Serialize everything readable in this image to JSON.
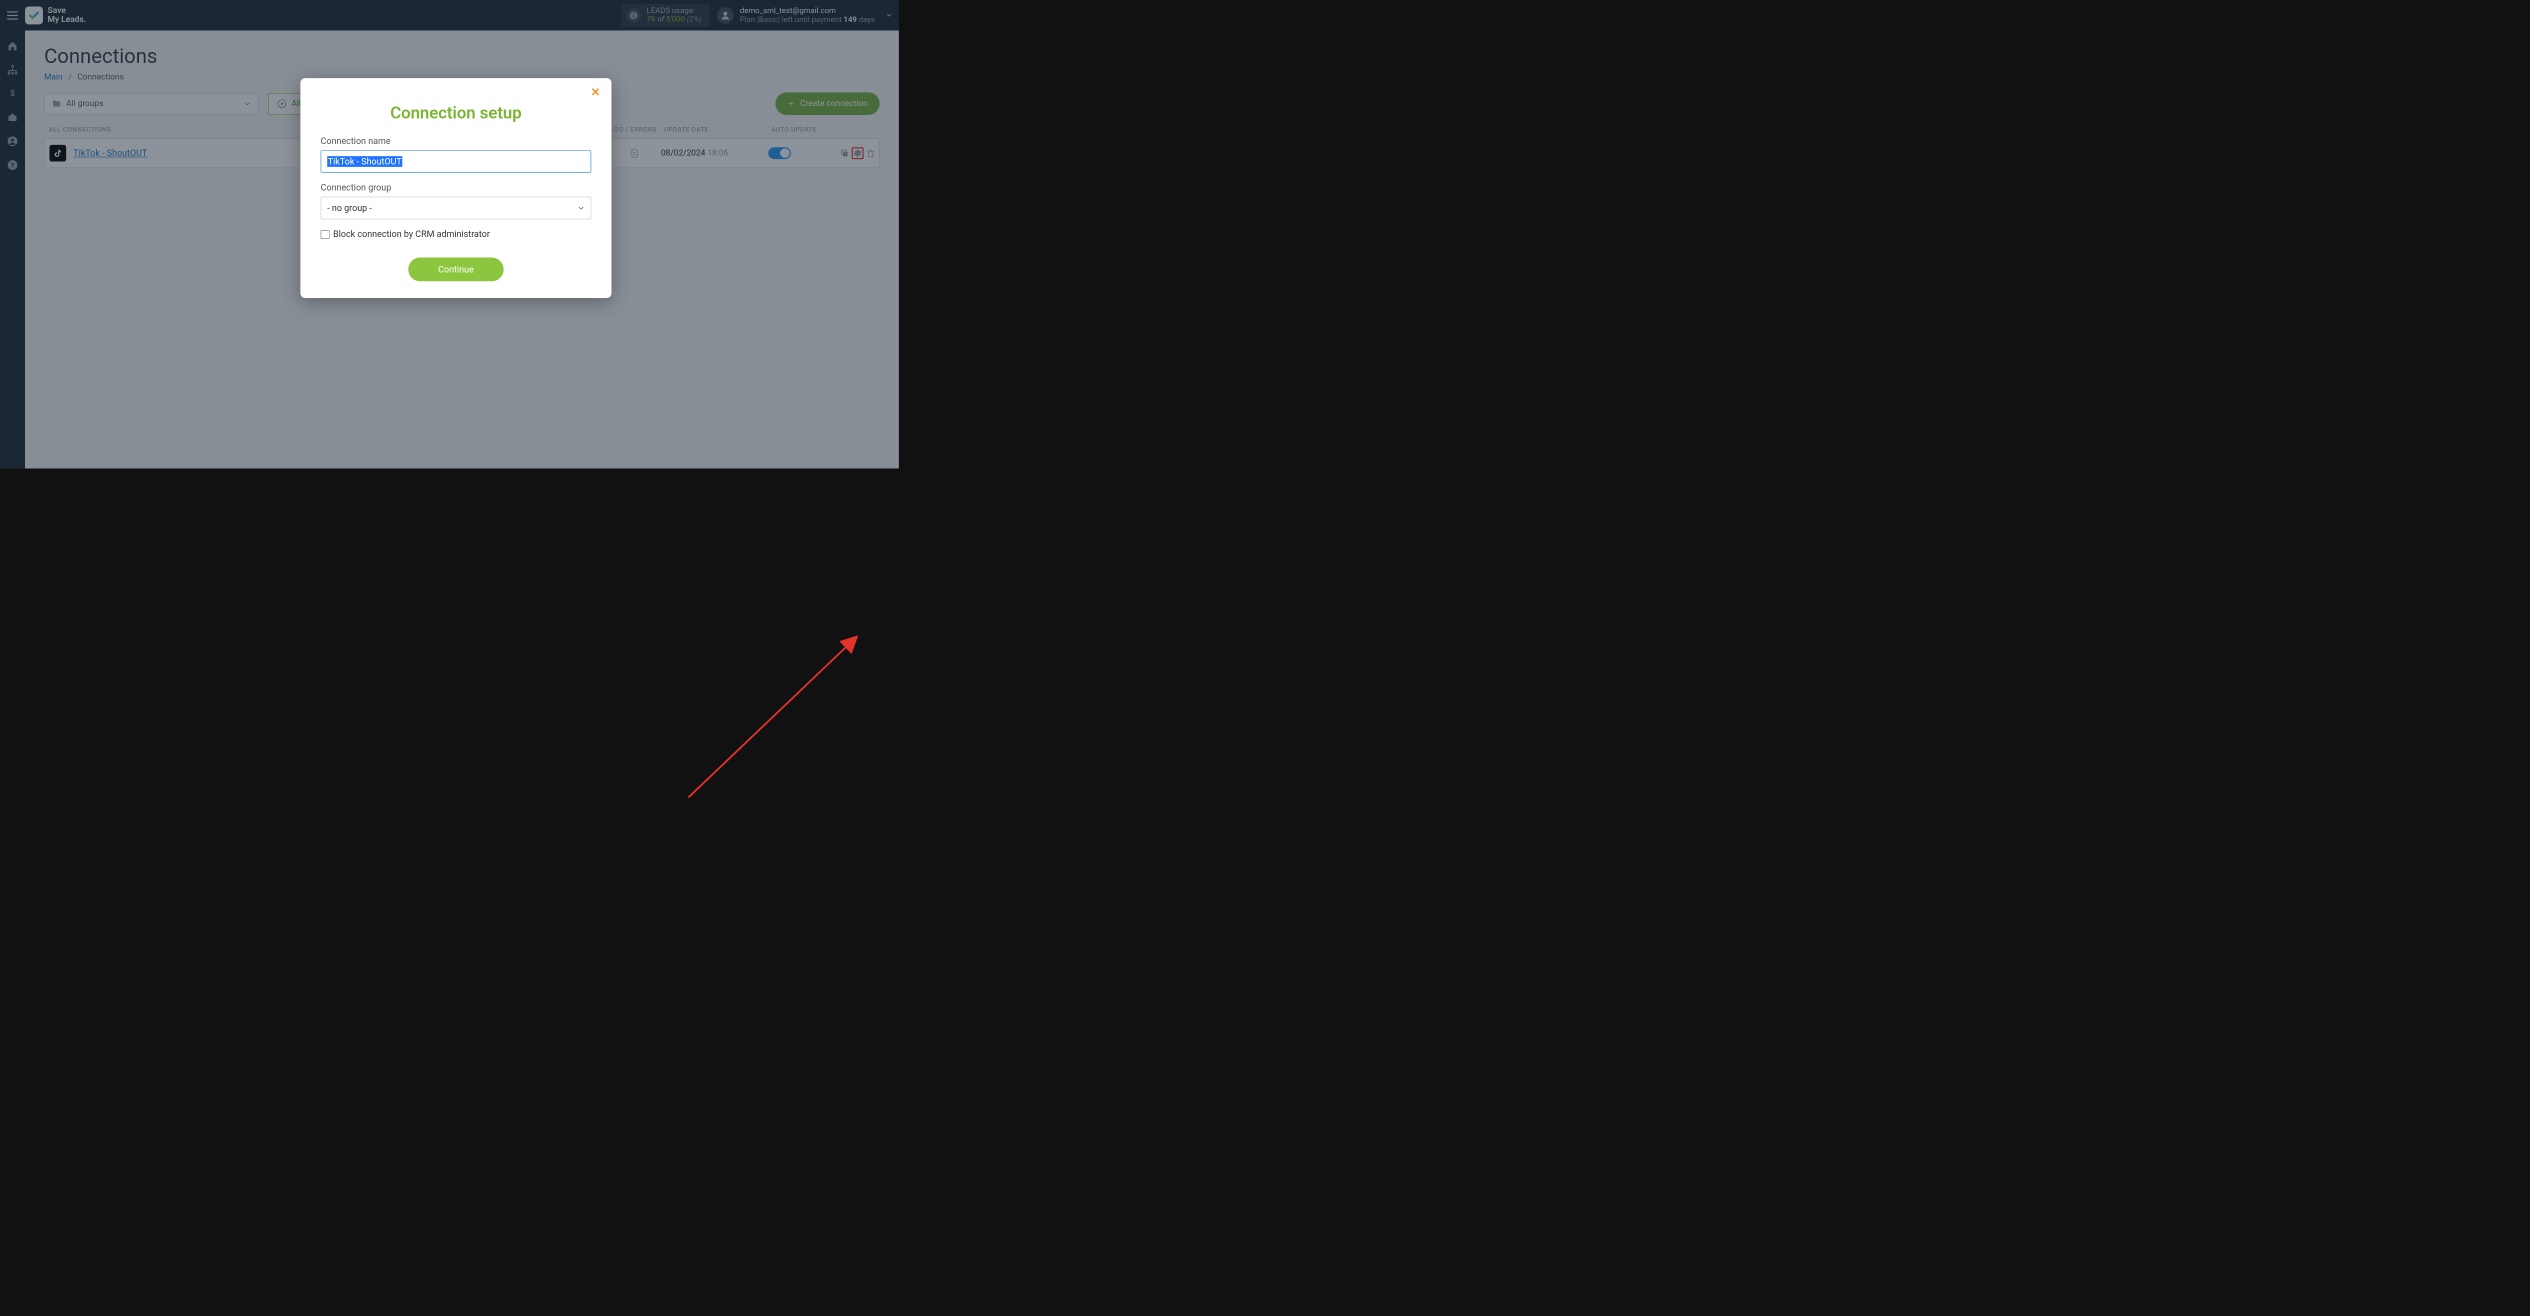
{
  "brand": {
    "line1": "Save",
    "line2": "My Leads."
  },
  "usage": {
    "label": "LEADS usage:",
    "used": "76",
    "of_word": "of",
    "limit": "5'000",
    "pct": "(2%)"
  },
  "account": {
    "email": "demo_sml_test@gmail.com",
    "plan_prefix": "Plan |",
    "plan_name": "Basic",
    "plan_mid": "| left until payment ",
    "days": "149",
    "days_word": " days"
  },
  "page": {
    "title": "Connections"
  },
  "breadcrumb": {
    "main": "Main",
    "current": "Connections"
  },
  "toolbar": {
    "group_select": "All groups",
    "start_all": "All connections",
    "create": "Create connection"
  },
  "table": {
    "header_all": "ALL CONNECTIONS",
    "header_log": "LOG / ERRORS",
    "header_date": "UPDATE DATE",
    "header_auto": "AUTO UPDATE"
  },
  "row": {
    "name": "TikTok - ShoutOUT",
    "date": "08/02/2024",
    "time": "18:06"
  },
  "modal": {
    "title": "Connection setup",
    "label_name": "Connection name",
    "value_name": "TikTok - ShoutOUT",
    "label_group": "Connection group",
    "value_group": "- no group -",
    "block_label": "Block connection by CRM administrator",
    "continue": "Continue"
  }
}
